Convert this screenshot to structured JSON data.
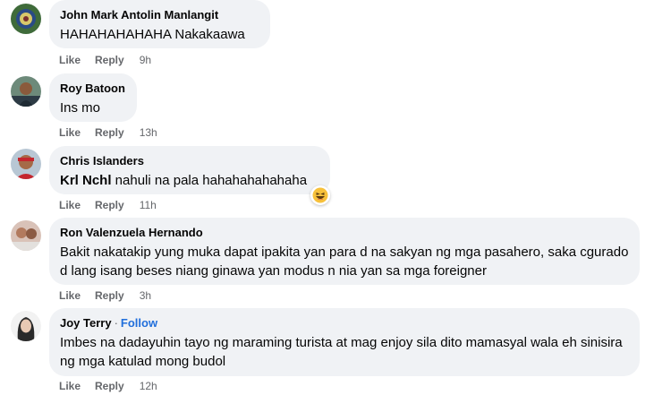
{
  "comments": [
    {
      "name": "John Mark Antolin Manlangit",
      "text": "HAHAHAHAHAHA Nakakaawa",
      "like": "Like",
      "reply": "Reply",
      "time": "9h"
    },
    {
      "name": "Roy Batoon",
      "text": "Ins mo",
      "like": "Like",
      "reply": "Reply",
      "time": "13h"
    },
    {
      "name": "Chris Islanders",
      "tag": "Krl Nchl",
      "text": " nahuli na pala hahahahahahaha",
      "reaction_icon": "laughing-face-icon",
      "like": "Like",
      "reply": "Reply",
      "time": "11h"
    },
    {
      "name": "Ron Valenzuela Hernando",
      "text": "Bakit nakatakip yung muka dapat ipakita yan para d na sakyan ng mga pasahero, saka cgurado d lang isang beses niang ginawa yan modus n nia yan sa mga foreigner",
      "like": "Like",
      "reply": "Reply",
      "time": "3h"
    },
    {
      "name": "Joy Terry",
      "separator": "·",
      "follow": "Follow",
      "text": "Imbes na dadayuhin tayo ng maraming turista at mag enjoy sila dito mamasyal wala eh sinisira ng mga katulad mong budol",
      "like": "Like",
      "reply": "Reply",
      "time": "12h"
    }
  ],
  "colors": {
    "bubble": "#f0f2f5",
    "secondary_text": "#65676b",
    "follow_link": "#216fdb"
  }
}
